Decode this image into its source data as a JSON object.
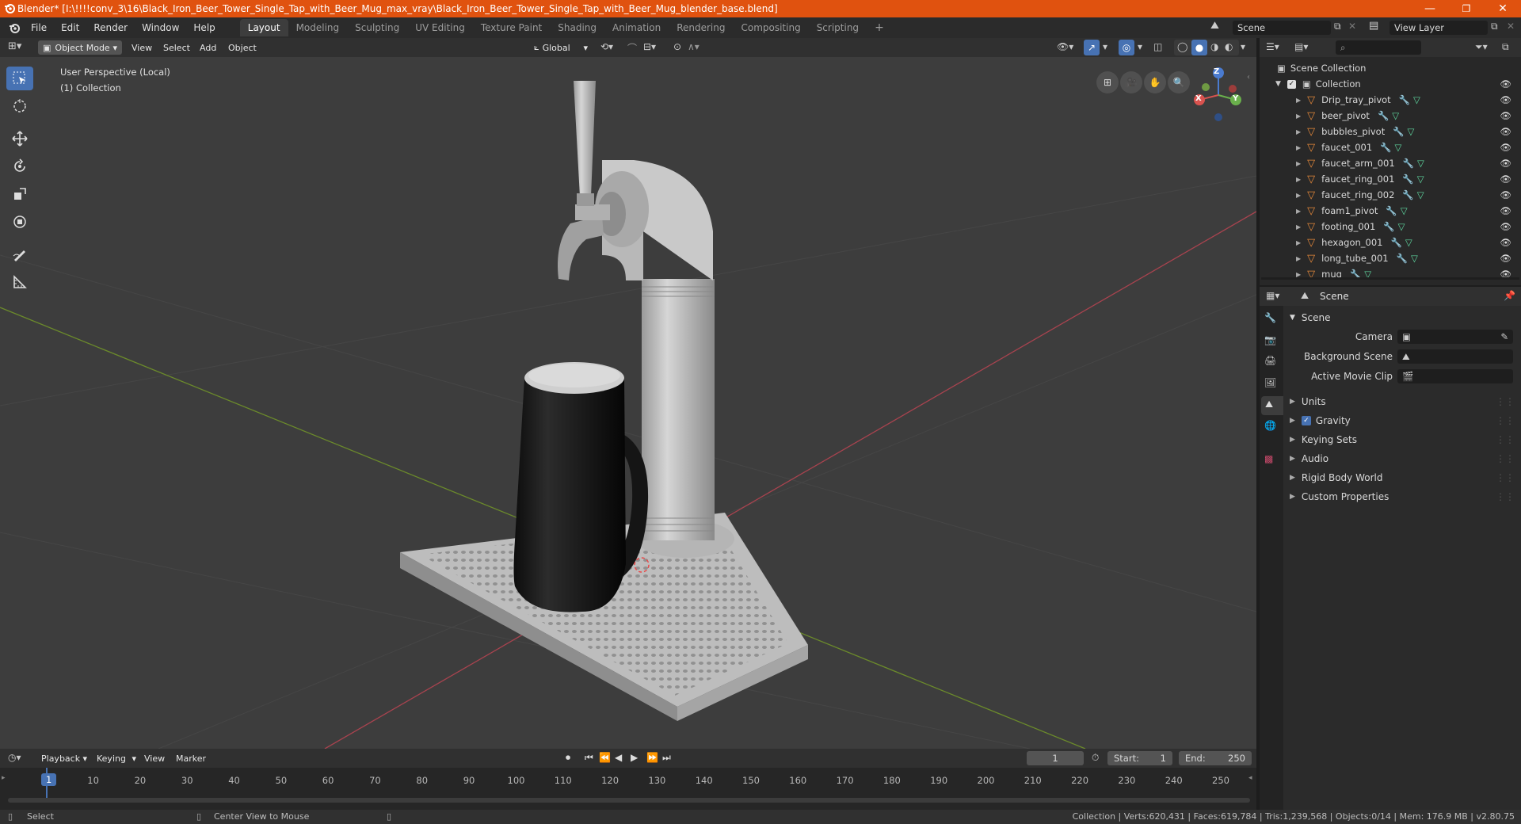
{
  "window": {
    "title": "Blender* [I:\\!!!!conv_3\\16\\Black_Iron_Beer_Tower_Single_Tap_with_Beer_Mug_max_vray\\Black_Iron_Beer_Tower_Single_Tap_with_Beer_Mug_blender_base.blend]",
    "minimize": "—",
    "maximize": "❐",
    "close": "✕"
  },
  "menu": [
    "File",
    "Edit",
    "Render",
    "Window",
    "Help"
  ],
  "workspaces": [
    "Layout",
    "Modeling",
    "Sculpting",
    "UV Editing",
    "Texture Paint",
    "Shading",
    "Animation",
    "Rendering",
    "Compositing",
    "Scripting",
    "+"
  ],
  "active_workspace": "Layout",
  "scene_selector": "Scene",
  "view_layer": "View Layer",
  "viewport_header": {
    "mode": "Object Mode",
    "menus": [
      "View",
      "Select",
      "Add",
      "Object"
    ],
    "orientation": "Global"
  },
  "viewport": {
    "perspective": "User Perspective (Local)",
    "collection": "(1) Collection",
    "gizmo_axes": [
      "X",
      "Y",
      "Z"
    ]
  },
  "outliner": {
    "search_placeholder": "",
    "root": "Scene Collection",
    "collection": "Collection",
    "items": [
      "Drip_tray_pivot",
      "beer_pivot",
      "bubbles_pivot",
      "faucet_001",
      "faucet_arm_001",
      "faucet_ring_001",
      "faucet_ring_002",
      "foam1_pivot",
      "footing_001",
      "hexagon_001",
      "long_tube_001",
      "mug"
    ]
  },
  "properties": {
    "context": "Scene",
    "panel": "Scene",
    "fields": [
      {
        "label": "Camera",
        "value": ""
      },
      {
        "label": "Background Scene",
        "value": ""
      },
      {
        "label": "Active Movie Clip",
        "value": ""
      }
    ],
    "sections": [
      "Units",
      "Gravity",
      "Keying Sets",
      "Audio",
      "Rigid Body World",
      "Custom Properties"
    ],
    "gravity_checked": true
  },
  "timeline": {
    "menus": [
      "Playback",
      "Keying",
      "View",
      "Marker"
    ],
    "current_frame": "1",
    "start_label": "Start:",
    "start": "1",
    "end_label": "End:",
    "end": "250",
    "ruler": [
      "1",
      "10",
      "20",
      "30",
      "40",
      "50",
      "60",
      "70",
      "80",
      "90",
      "100",
      "110",
      "120",
      "130",
      "140",
      "150",
      "160",
      "170",
      "180",
      "190",
      "200",
      "210",
      "220",
      "230",
      "240",
      "250"
    ]
  },
  "status": {
    "left_action": "Select",
    "mid_action": "Center View to Mouse",
    "stats": "Collection | Verts:620,431 | Faces:619,784 | Tris:1,239,568 | Objects:0/14 | Mem: 176.9 MB | v2.80.75"
  },
  "colors": {
    "accent": "#4772b3",
    "titlebar": "#e0520f",
    "mesh_orange": "#e6893a",
    "mesh_green": "#5fd7a0"
  }
}
